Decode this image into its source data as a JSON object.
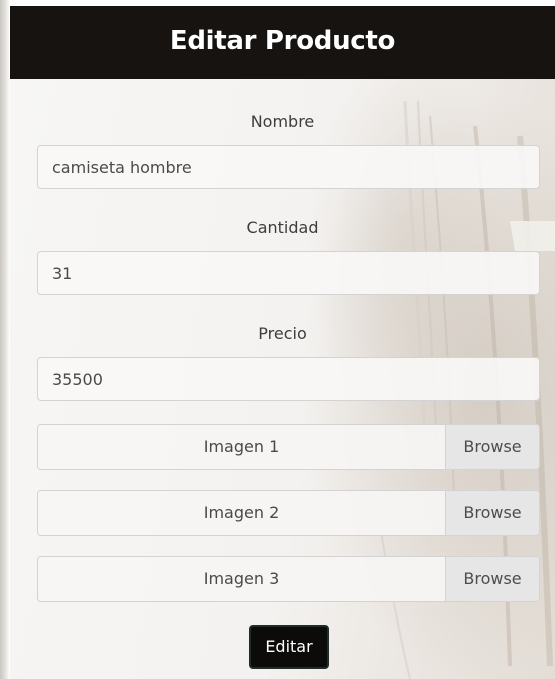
{
  "form": {
    "title": "Editar Producto",
    "fields": [
      {
        "label": "Nombre",
        "value": "camiseta hombre"
      },
      {
        "label": "Cantidad",
        "value": "31"
      },
      {
        "label": "Precio",
        "value": "35500"
      }
    ],
    "files": [
      {
        "label": "Imagen 1",
        "button": "Browse"
      },
      {
        "label": "Imagen 2",
        "button": "Browse"
      },
      {
        "label": "Imagen 3",
        "button": "Browse"
      }
    ],
    "submit_label": "Editar"
  },
  "colors": {
    "header_background": "#161311",
    "header_text": "#ffffff",
    "button_background": "#0c0b0a",
    "browse_background": "#e6e6e6"
  }
}
